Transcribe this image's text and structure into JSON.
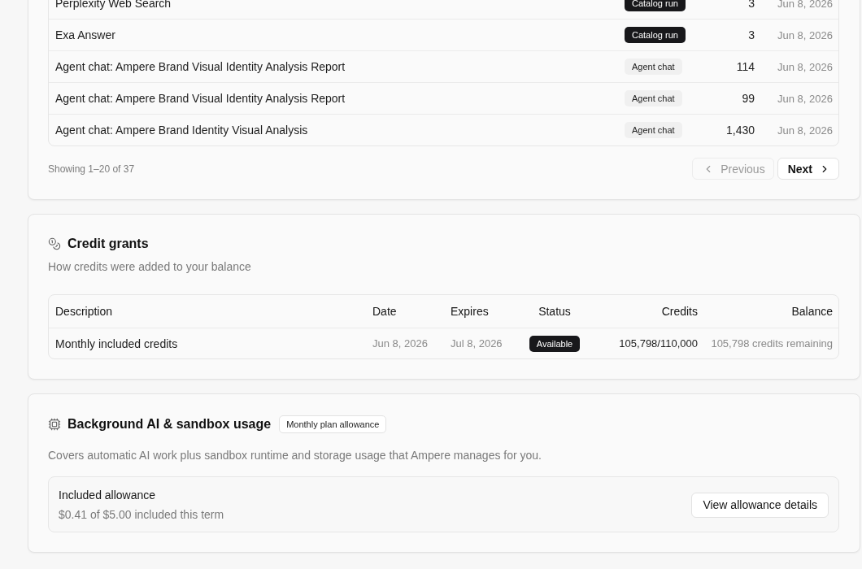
{
  "usage_table": {
    "rows": [
      {
        "text": "Perplexity Web Search",
        "tag": {
          "label": "Catalog run",
          "kind": "solid"
        },
        "number": "3",
        "date": "Jun 8, 2026"
      },
      {
        "text": "Exa Answer",
        "tag": {
          "label": "Catalog run",
          "kind": "solid"
        },
        "number": "3",
        "date": "Jun 8, 2026"
      },
      {
        "text": "Agent chat: Ampere Brand Visual Identity Analysis Report",
        "tag": {
          "label": "Agent chat",
          "kind": "soft"
        },
        "number": "114",
        "date": "Jun 8, 2026"
      },
      {
        "text": "Agent chat: Ampere Brand Visual Identity Analysis Report",
        "tag": {
          "label": "Agent chat",
          "kind": "soft"
        },
        "number": "99",
        "date": "Jun 8, 2026"
      },
      {
        "text": "Agent chat: Ampere Brand Identity Visual Analysis",
        "tag": {
          "label": "Agent chat",
          "kind": "soft"
        },
        "number": "1,430",
        "date": "Jun 8, 2026"
      }
    ]
  },
  "pagination": {
    "summary": "Showing 1–20 of 37",
    "previous": {
      "label": "Previous",
      "disabled": true
    },
    "next": {
      "label": "Next",
      "disabled": false
    }
  },
  "credit_grants": {
    "title": "Credit grants",
    "subtitle": "How credits were added to your balance",
    "table": {
      "columns": [
        "Description",
        "Date",
        "Expires",
        "Status",
        "Credits",
        "Balance"
      ],
      "rows": [
        {
          "description": "Monthly included credits",
          "date": "Jun 8, 2026",
          "expires": "Jul 8, 2026",
          "status": {
            "label": "Available",
            "kind": "solid"
          },
          "credits": "105,798/110,000",
          "balance": "105,798 credits remaining"
        }
      ]
    }
  },
  "background_usage": {
    "title": "Background AI & sandbox usage",
    "badge": "Monthly plan allowance",
    "description": "Covers automatic AI work plus sandbox runtime and storage usage that Ampere manages for you.",
    "allowance": {
      "title": "Included allowance",
      "detail": "$0.41 of $5.00 included this term",
      "button": "View allowance details"
    }
  }
}
